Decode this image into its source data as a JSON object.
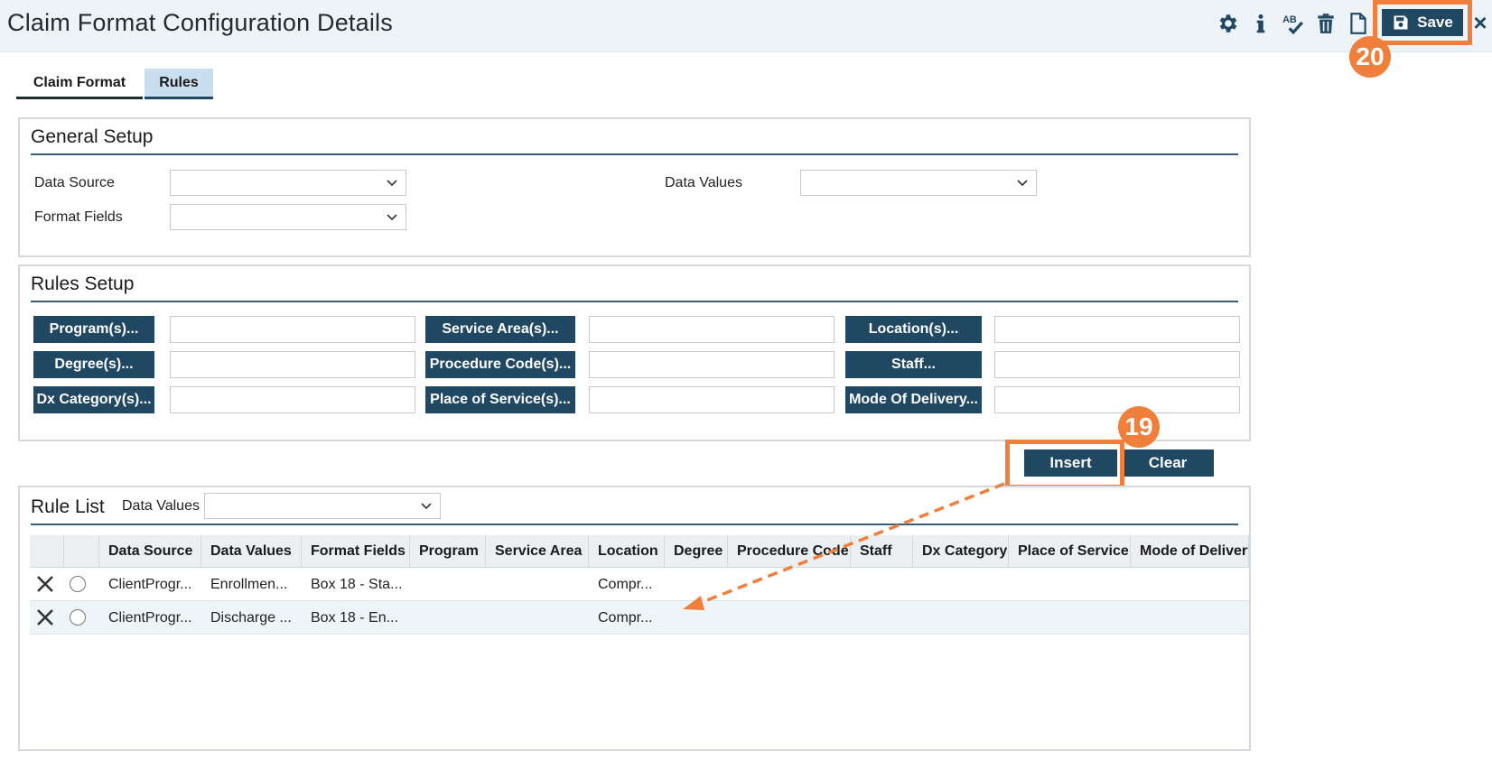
{
  "header": {
    "title": "Claim Format Configuration Details",
    "save_label": "Save",
    "close_label": "×",
    "tool_icons": [
      "gear-icon",
      "info-icon",
      "spellcheck-icon",
      "trash-icon",
      "document-icon",
      "save-icon"
    ]
  },
  "annotations": {
    "step_save": "20",
    "step_insert": "19",
    "accent_color": "#ef7f3a"
  },
  "tabs": [
    {
      "label": "Claim Format",
      "active": false
    },
    {
      "label": "Rules",
      "active": true
    }
  ],
  "general_setup": {
    "title": "General Setup",
    "data_source_label": "Data Source",
    "data_source_value": "",
    "format_fields_label": "Format Fields",
    "format_fields_value": "",
    "data_values_label": "Data Values",
    "data_values_value": ""
  },
  "rules_setup": {
    "title": "Rules Setup",
    "buttons": {
      "programs": "Program(s)...",
      "service_areas": "Service Area(s)...",
      "locations": "Location(s)...",
      "degrees": "Degree(s)...",
      "procedure_codes": "Procedure Code(s)...",
      "staff": "Staff...",
      "dx_categories": "Dx Category(s)...",
      "place_of_service": "Place of Service(s)...",
      "mode_of_delivery": "Mode Of Delivery..."
    }
  },
  "actions": {
    "insert_label": "Insert",
    "clear_label": "Clear"
  },
  "rule_list": {
    "title": "Rule List",
    "data_values_label": "Data Values",
    "data_values_value": "",
    "columns": [
      "Data Source",
      "Data Values",
      "Format Fields",
      "Program",
      "Service Area",
      "Location",
      "Degree",
      "Procedure Code",
      "Staff",
      "Dx Category",
      "Place of Service",
      "Mode of Delivery"
    ],
    "rows": [
      {
        "data_source": "ClientProgr...",
        "data_values": "Enrollmen...",
        "format_fields": "Box 18 - Sta...",
        "program": "",
        "service_area": "",
        "location": "Compr...",
        "degree": "",
        "procedure_code": "",
        "staff": "",
        "dx_category": "",
        "place_of_service": "",
        "mode_of_delivery": ""
      },
      {
        "data_source": "ClientProgr...",
        "data_values": "Discharge ...",
        "format_fields": "Box 18 - En...",
        "program": "",
        "service_area": "",
        "location": "Compr...",
        "degree": "",
        "procedure_code": "",
        "staff": "",
        "dx_category": "",
        "place_of_service": "",
        "mode_of_delivery": ""
      }
    ]
  },
  "colors": {
    "primary": "#214863",
    "header_bg": "#eef3f8",
    "active_tab": "#c9dff0"
  }
}
